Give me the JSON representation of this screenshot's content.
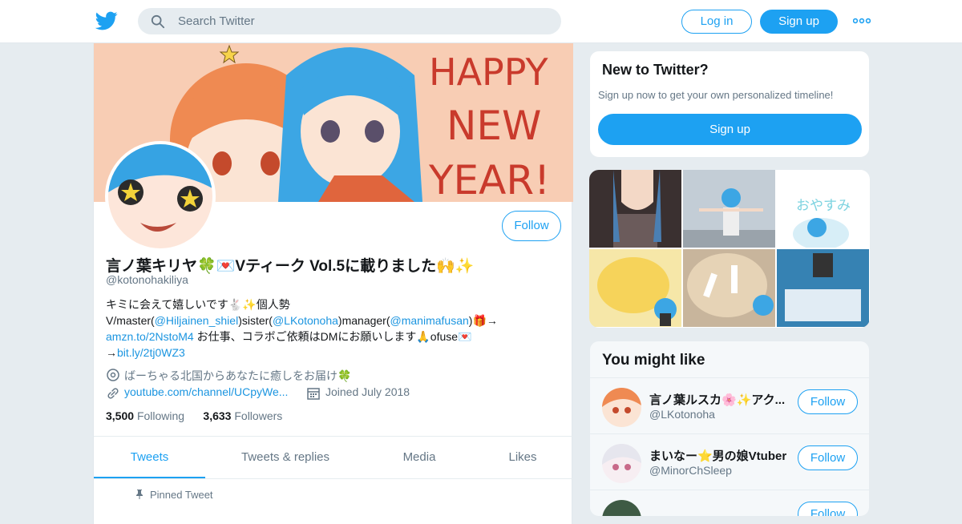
{
  "colors": {
    "accent": "#1da1f2",
    "link": "#1b95e0",
    "muted": "#657786",
    "page_bg": "#e6ecf0"
  },
  "topbar": {
    "search_placeholder": "Search Twitter",
    "login": "Log in",
    "signup": "Sign up",
    "logo_icon": "twitter-bird-icon",
    "more_icon": "more-dots-icon"
  },
  "banner": {
    "text": [
      "HAPPY",
      "NEW",
      "YEAR!"
    ]
  },
  "profile": {
    "follow": "Follow",
    "name": "言ノ葉キリヤ🍀💌Vティーク Vol.5に載りました🙌✨",
    "handle": "@kotonohakiliya",
    "bio": {
      "line1": "キミに会えて嬉しいです🐇✨個人勢",
      "l2_a": "V/master(",
      "l2_link1": "@Hiljainen_shiel",
      "l2_b": ")sister(",
      "l2_link2": "@LKotonoha",
      "l2_c": ")manager(",
      "l2_link3": "@manimafusan",
      "l2_d": ")🎁→",
      "l3_link": "amzn.to/2NstoM4",
      "l3_text": " お仕事、コラボご依頼はDMにお願いします🙏ofuse💌",
      "l4_arrow": "→",
      "l4_link": "bit.ly/2tj0WZ3"
    },
    "location": "ばーちゃる北国からあなたに癒しをお届け🍀",
    "url": "youtube.com/channel/UCpyWe...",
    "joined": "Joined July 2018",
    "following_count": "3,500",
    "following_label": "Following",
    "followers_count": "3,633",
    "followers_label": "Followers",
    "tabs": [
      "Tweets",
      "Tweets & replies",
      "Media",
      "Likes"
    ],
    "pinned": "Pinned Tweet"
  },
  "new_to_twitter": {
    "title": "New to Twitter?",
    "text": "Sign up now to get your own personalized timeline!",
    "button": "Sign up"
  },
  "media_grid": {
    "text": "おやすみ"
  },
  "you_might_like": {
    "title": "You might like",
    "follow": "Follow",
    "accounts": [
      {
        "name": "言ノ葉ルスカ🌸✨アク...",
        "handle": "@LKotonoha"
      },
      {
        "name": "まいなー⭐男の娘Vtuber",
        "handle": "@MinorChSleep"
      }
    ]
  }
}
